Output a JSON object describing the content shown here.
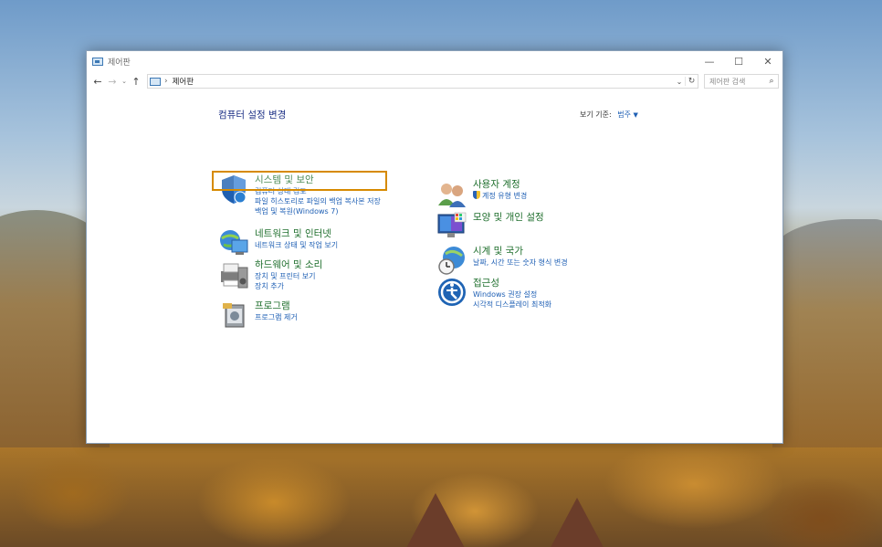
{
  "window": {
    "title": "제어판",
    "minimize": "—",
    "maximize": "☐",
    "close": "✕"
  },
  "address": {
    "path": "제어판",
    "separator": "›",
    "search_placeholder": "제어판 검색"
  },
  "main": {
    "title": "컴퓨터 설정 변경",
    "view_by_label": "보기 기준:",
    "view_by_value": "범주"
  },
  "categories": [
    {
      "title": "시스템 및 보안",
      "links": [
        "컴퓨터 상태 검토",
        "파일 히스토리로 파일의 백업 복사본 저장",
        "백업 및 복원(Windows 7)"
      ]
    },
    {
      "title": "네트워크 및 인터넷",
      "links": [
        "네트워크 상태 및 작업 보기"
      ]
    },
    {
      "title": "하드웨어 및 소리",
      "links": [
        "장치 및 프린터 보기",
        "장치 추가"
      ]
    },
    {
      "title": "프로그램",
      "links": [
        "프로그램 제거"
      ]
    },
    {
      "title": "사용자 계정",
      "links": [
        "계정 유형 변경"
      ]
    },
    {
      "title": "모양 및 개인 설정",
      "links": []
    },
    {
      "title": "시계 및 국가",
      "links": [
        "날짜, 시간 또는 숫자 형식 변경"
      ]
    },
    {
      "title": "접근성",
      "links": [
        "Windows 권장 설정",
        "시각적 디스플레이 최적화"
      ]
    }
  ]
}
